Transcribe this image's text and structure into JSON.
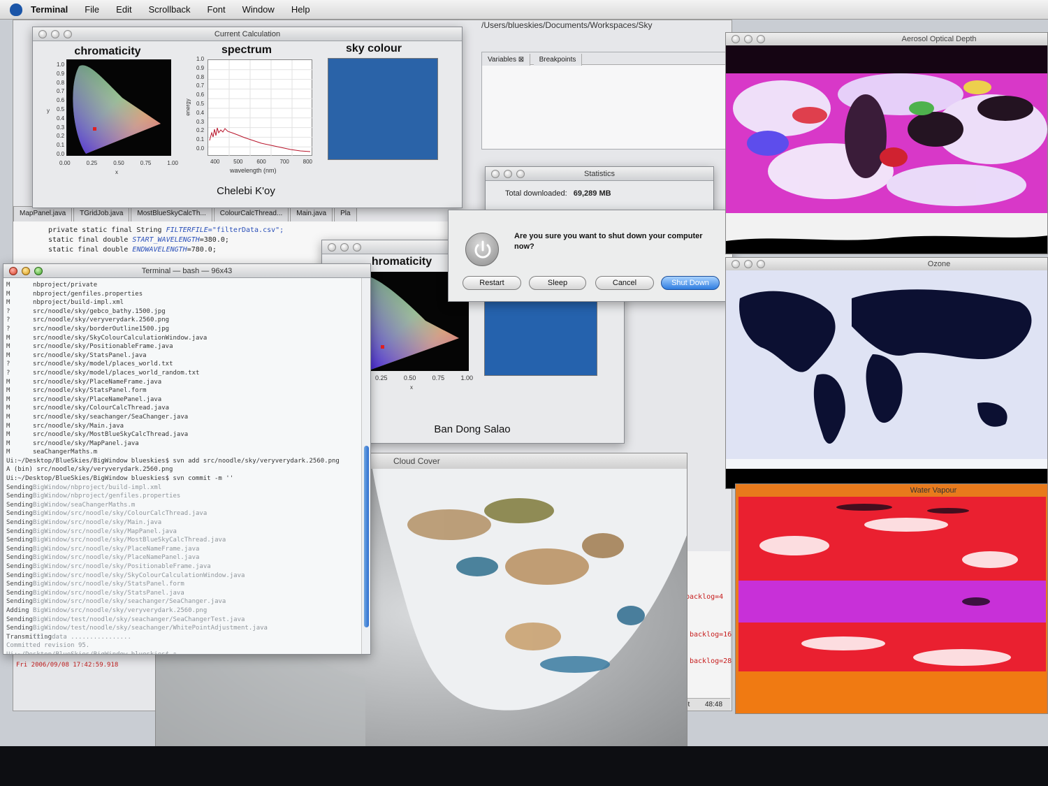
{
  "menubar": {
    "items": [
      "Terminal",
      "File",
      "Edit",
      "Scrollback",
      "Font",
      "Window",
      "Help"
    ]
  },
  "ide": {
    "path": "/Users/blueskies/Documents/Workspaces/Sky",
    "variables_tab": "Variables",
    "breakpoints_tab": "Breakpoints",
    "tabs": [
      "MapPanel.java",
      "TGridJob.java",
      "MostBlueSkyCalcTh...",
      "ColourCalcThread...",
      "Main.java",
      "Pla"
    ],
    "code": [
      {
        "kw": "private static final String ",
        "it": "FILTERFILE",
        "rest": "=\"filterData.csv\";"
      },
      {
        "kw": "static final double ",
        "it": "START_WAVELENGTH",
        "rest": "=380.0;"
      },
      {
        "kw": "static final double ",
        "it": "ENDWAVELENGTH",
        "rest": "=780.0;"
      }
    ],
    "log_entries": [
      "backlog=4",
      "backlog=16",
      "backlog=28"
    ],
    "status_time": "48:48",
    "status_label": "pt"
  },
  "current_calc": {
    "window_title": "Current Calculation",
    "chromaticity_title": "chromaticity",
    "spectrum_title": "spectrum",
    "sky_colour_title": "sky colour",
    "place": "Chelebi K'oy",
    "chroma_x_label": "x",
    "chroma_y_label": "y",
    "chroma_x_ticks": [
      "0.00",
      "0.25",
      "0.50",
      "0.75",
      "1.00"
    ],
    "chroma_y_ticks": [
      "1.0",
      "0.9",
      "0.8",
      "0.7",
      "0.6",
      "0.5",
      "0.4",
      "0.3",
      "0.2",
      "0.1",
      "0.0"
    ],
    "spectrum_x_label": "wavelength (nm)",
    "spectrum_y_label": "energy",
    "spectrum_x_ticks": [
      "400",
      "500",
      "600",
      "700",
      "800"
    ],
    "spectrum_y_ticks": [
      "1.0",
      "0.9",
      "0.8",
      "0.7",
      "0.6",
      "0.5",
      "0.4",
      "0.3",
      "0.2",
      "0.1",
      "0.0"
    ],
    "sky_colour_hex": "#2a63a8"
  },
  "second_calc": {
    "chromaticity_title": "hromaticity",
    "place": "Ban Dong Salao",
    "x_ticks": [
      "0.25",
      "0.50",
      "0.75",
      "1.00"
    ],
    "x_label": "x",
    "sky_colour_hex": "#2562ad"
  },
  "statistics": {
    "window_title": "Statistics",
    "label": "Total downloaded:",
    "value": "69,289 MB"
  },
  "dialog": {
    "message": "Are you sure you want to shut down your computer now?",
    "buttons": {
      "restart": "Restart",
      "sleep": "Sleep",
      "cancel": "Cancel",
      "shutdown": "Shut Down"
    }
  },
  "terminal": {
    "window_title": "Terminal — bash — 96x43",
    "lines": [
      {
        "s": "M",
        "t": "nbproject/private"
      },
      {
        "s": "M",
        "t": "nbproject/genfiles.properties"
      },
      {
        "s": "M",
        "t": "nbproject/build-impl.xml"
      },
      {
        "s": "?",
        "t": "src/noodle/sky/gebco_bathy.1500.jpg"
      },
      {
        "s": "?",
        "t": "src/noodle/sky/veryverydark.2560.png"
      },
      {
        "s": "?",
        "t": "src/noodle/sky/borderOutline1500.jpg"
      },
      {
        "s": "M",
        "t": "src/noodle/sky/SkyColourCalculationWindow.java"
      },
      {
        "s": "M",
        "t": "src/noodle/sky/PositionableFrame.java"
      },
      {
        "s": "M",
        "t": "src/noodle/sky/StatsPanel.java"
      },
      {
        "s": "?",
        "t": "src/noodle/sky/model/places_world.txt"
      },
      {
        "s": "?",
        "t": "src/noodle/sky/model/places_world_random.txt"
      },
      {
        "s": "M",
        "t": "src/noodle/sky/PlaceNameFrame.java"
      },
      {
        "s": "M",
        "t": "src/noodle/sky/StatsPanel.form"
      },
      {
        "s": "M",
        "t": "src/noodle/sky/PlaceNamePanel.java"
      },
      {
        "s": "M",
        "t": "src/noodle/sky/ColourCalcThread.java"
      },
      {
        "s": "M",
        "t": "src/noodle/sky/seachanger/SeaChanger.java"
      },
      {
        "s": "M",
        "t": "src/noodle/sky/Main.java"
      },
      {
        "s": "M",
        "t": "src/noodle/sky/MostBlueSkyCalcThread.java"
      },
      {
        "s": "M",
        "t": "src/noodle/sky/MapPanel.java"
      },
      {
        "s": "M",
        "t": "seaChangerMaths.m"
      },
      {
        "s": "",
        "t": "Ui:~/Desktop/BlueSkies/BigWindow blueskies$ svn add   src/noodle/sky/veryverydark.2560.png"
      },
      {
        "s": "",
        "t": "A  (bin)  src/noodle/sky/veryverydark.2560.png"
      },
      {
        "s": "",
        "t": "Ui:~/Desktop/BlueSkies/BigWindow blueskies$ svn commit -m ''"
      },
      {
        "s": "Sending",
        "t": "BigWindow/nbproject/build-impl.xml"
      },
      {
        "s": "Sending",
        "t": "BigWindow/nbproject/genfiles.properties"
      },
      {
        "s": "Sending",
        "t": "BigWindow/seaChangerMaths.m"
      },
      {
        "s": "Sending",
        "t": "BigWindow/src/noodle/sky/ColourCalcThread.java"
      },
      {
        "s": "Sending",
        "t": "BigWindow/src/noodle/sky/Main.java"
      },
      {
        "s": "Sending",
        "t": "BigWindow/src/noodle/sky/MapPanel.java"
      },
      {
        "s": "Sending",
        "t": "BigWindow/src/noodle/sky/MostBlueSkyCalcThread.java"
      },
      {
        "s": "Sending",
        "t": "BigWindow/src/noodle/sky/PlaceNameFrame.java"
      },
      {
        "s": "Sending",
        "t": "BigWindow/src/noodle/sky/PlaceNamePanel.java"
      },
      {
        "s": "Sending",
        "t": "BigWindow/src/noodle/sky/PositionableFrame.java"
      },
      {
        "s": "Sending",
        "t": "BigWindow/src/noodle/sky/SkyColourCalculationWindow.java"
      },
      {
        "s": "Sending",
        "t": "BigWindow/src/noodle/sky/StatsPanel.form"
      },
      {
        "s": "Sending",
        "t": "BigWindow/src/noodle/sky/StatsPanel.java"
      },
      {
        "s": "Sending",
        "t": "BigWindow/src/noodle/sky/seachanger/SeaChanger.java"
      },
      {
        "s": "Adding",
        "t": "BigWindow/src/noodle/sky/veryverydark.2560.png"
      },
      {
        "s": "Sending",
        "t": "BigWindow/test/noodle/sky/seachanger/SeaChangerTest.java"
      },
      {
        "s": "Sending",
        "t": "BigWindow/test/noodle/sky/seachanger/WhitePointAdjustment.java"
      },
      {
        "s": "Transmitting",
        "t": "file data ................"
      },
      {
        "s": "",
        "t": "Committed revision 95."
      },
      {
        "s": "",
        "t": "Ui:~/Desktop/BlueSkies/BigWindow blueskies$ ▯"
      }
    ],
    "timestamp_line": "Fri 2006/09/08 17:42:59.918"
  },
  "maps": {
    "aerosol_title": "Aerosol Optical Depth",
    "ozone_title": "Ozone",
    "water_title": "Water Vapour",
    "cloud_title": "Cloud Cover"
  }
}
